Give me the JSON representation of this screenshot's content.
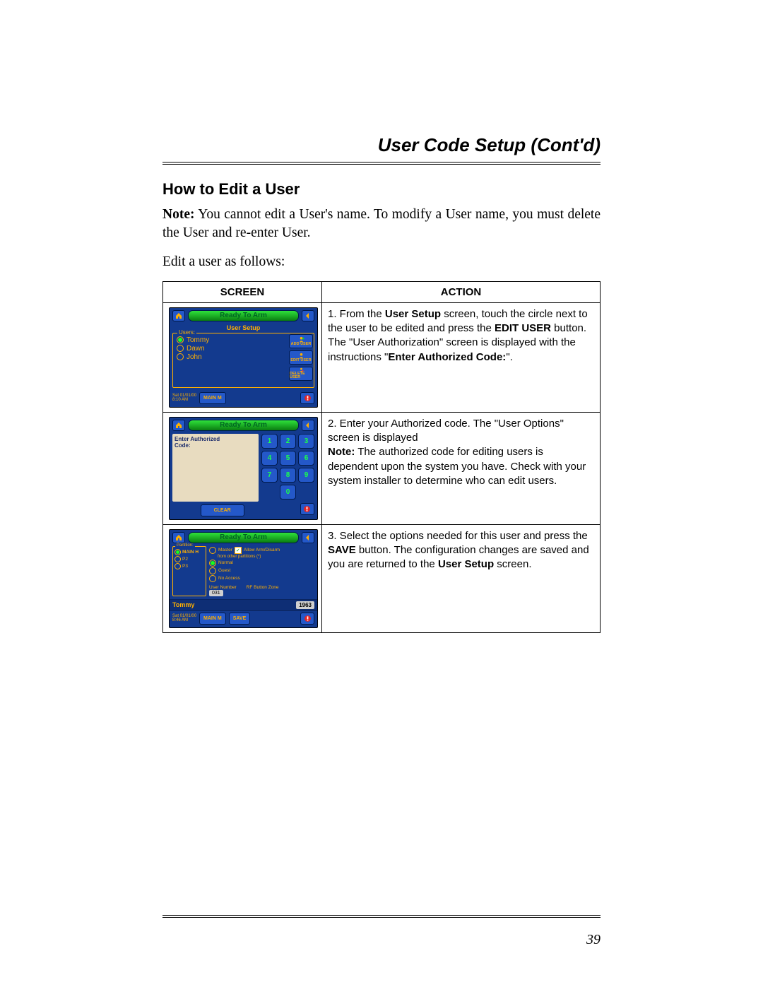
{
  "chapter_title": "User Code Setup (Cont'd)",
  "section_title": "How to Edit a User",
  "note_label": "Note:",
  "note_text": " You cannot edit a User's name. To modify a User name, you must delete the User and re-enter User.",
  "intro_text": "Edit a user as follows:",
  "table_headers": {
    "screen": "SCREEN",
    "action": "ACTION"
  },
  "steps": [
    {
      "num": "1.",
      "lead": "  From the ",
      "b1": "User Setup",
      "mid1": " screen, touch the circle next to the user to be edited and press the ",
      "b2": "EDIT USER",
      "mid2": " button.  The \"User Authorization\" screen is displayed with the instructions \"",
      "b3": "Enter Authorized Code:",
      "tail": "\"."
    },
    {
      "num": "2.",
      "lead": "  Enter your Authorized code.  The \"User Options\" screen is displayed",
      "note_label": "Note:",
      "note_body": " The authorized code for editing users is dependent upon the system you have. Check with your system installer to determine who can edit users."
    },
    {
      "num": "3.",
      "lead": "  Select the options needed for this user and press the ",
      "b1": "SAVE",
      "mid1": " button.  The configuration changes are saved and you are returned to the ",
      "b2": "User Setup",
      "tail": " screen."
    }
  ],
  "device": {
    "status": "Ready To Arm",
    "subtitle": "User Setup",
    "users_legend": "Users:",
    "users": [
      "Tommy",
      "Dawn",
      "John"
    ],
    "side_buttons": [
      "ADD USER",
      "EDIT USER",
      "DELETE USER"
    ],
    "time1": "Sat 01/01/00\n8:10 AM",
    "time3": "Sat 01/01/00\n8:46 AM",
    "main_btn": "MAIN M",
    "save_btn": "SAVE",
    "clear_btn": "CLEAR",
    "prompt_line1": "Enter Authorized",
    "prompt_line2": "Code:",
    "keypad": [
      "1",
      "2",
      "3",
      "4",
      "5",
      "6",
      "7",
      "8",
      "9",
      "0"
    ],
    "part_legend": "Partition:",
    "partitions": [
      "MAIN H",
      "P2",
      "P3"
    ],
    "roles": [
      "Master",
      "Normal",
      "Guest",
      "No Access"
    ],
    "allow_label": "Allow Arm/Disarm",
    "allow_sub": "from other partitions (*)",
    "user_number_label": "User Number",
    "user_number": "031",
    "rf_label": "RF Button Zone",
    "edit_name": "Tommy",
    "edit_code": "1963"
  },
  "page_number": "39"
}
